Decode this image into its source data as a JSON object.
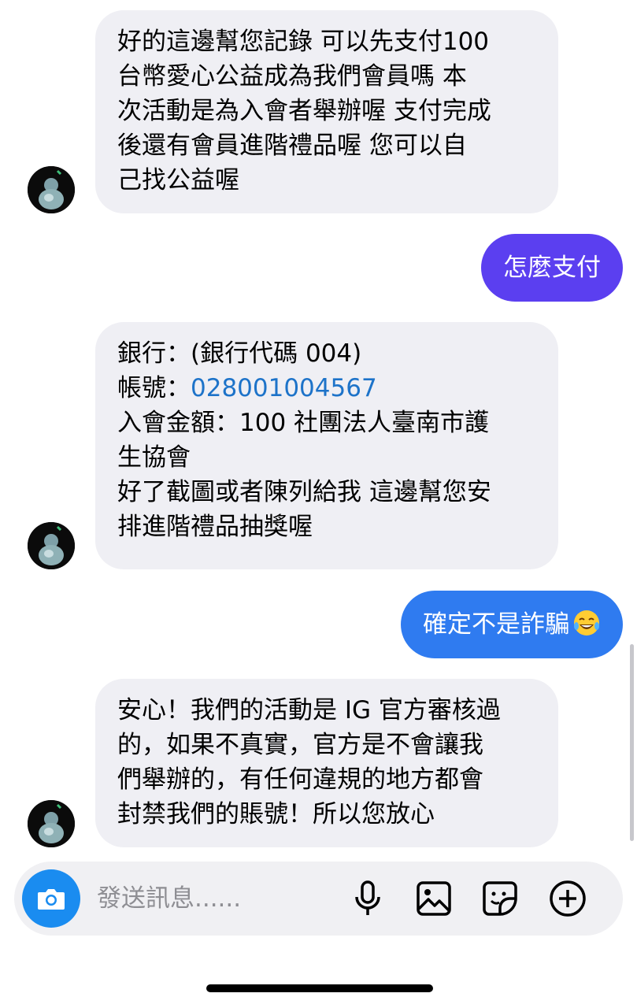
{
  "conversation": {
    "messages": [
      {
        "direction": "incoming",
        "lines": [
          "好的這邊幫您記錄 可以先支付100",
          "台幣愛心公益成為我們會員嗎  本",
          "次活動是為入會者舉辦喔 支付完成",
          "後還有會員進階禮品喔  您可以自",
          "己找公益喔"
        ]
      },
      {
        "direction": "outgoing",
        "text": "怎麼支付",
        "color": "#5b3ff0"
      },
      {
        "direction": "incoming",
        "lines_before": [
          "銀行：(銀行代碼 004)"
        ],
        "account_label": "帳號：",
        "account_number": "028001004567",
        "lines_after": [
          "入會金額：100 社團法人臺南市護",
          "生協會",
          "好了截圖或者陳列給我 這邊幫您安",
          "排進階禮品抽獎喔"
        ]
      },
      {
        "direction": "outgoing",
        "text": "確定不是詐騙",
        "emoji": "laughing-crying-emoji",
        "color": "#2f7bf0"
      },
      {
        "direction": "incoming",
        "lines": [
          "安心！我們的活動是 IG 官方審核過",
          "的，如果不真實，官方是不會讓我",
          "們舉辦的，有任何違規的地方都會",
          "封禁我們的賬號！所以您放心"
        ]
      }
    ]
  },
  "composer": {
    "placeholder": "發送訊息......",
    "icons": [
      "camera-icon",
      "microphone-icon",
      "gallery-icon",
      "sticker-icon",
      "plus-circle-icon"
    ]
  },
  "theme": {
    "incoming_bubble": "#efeff4",
    "camera_button": "#1a8cf0",
    "link": "#1d73c9"
  }
}
